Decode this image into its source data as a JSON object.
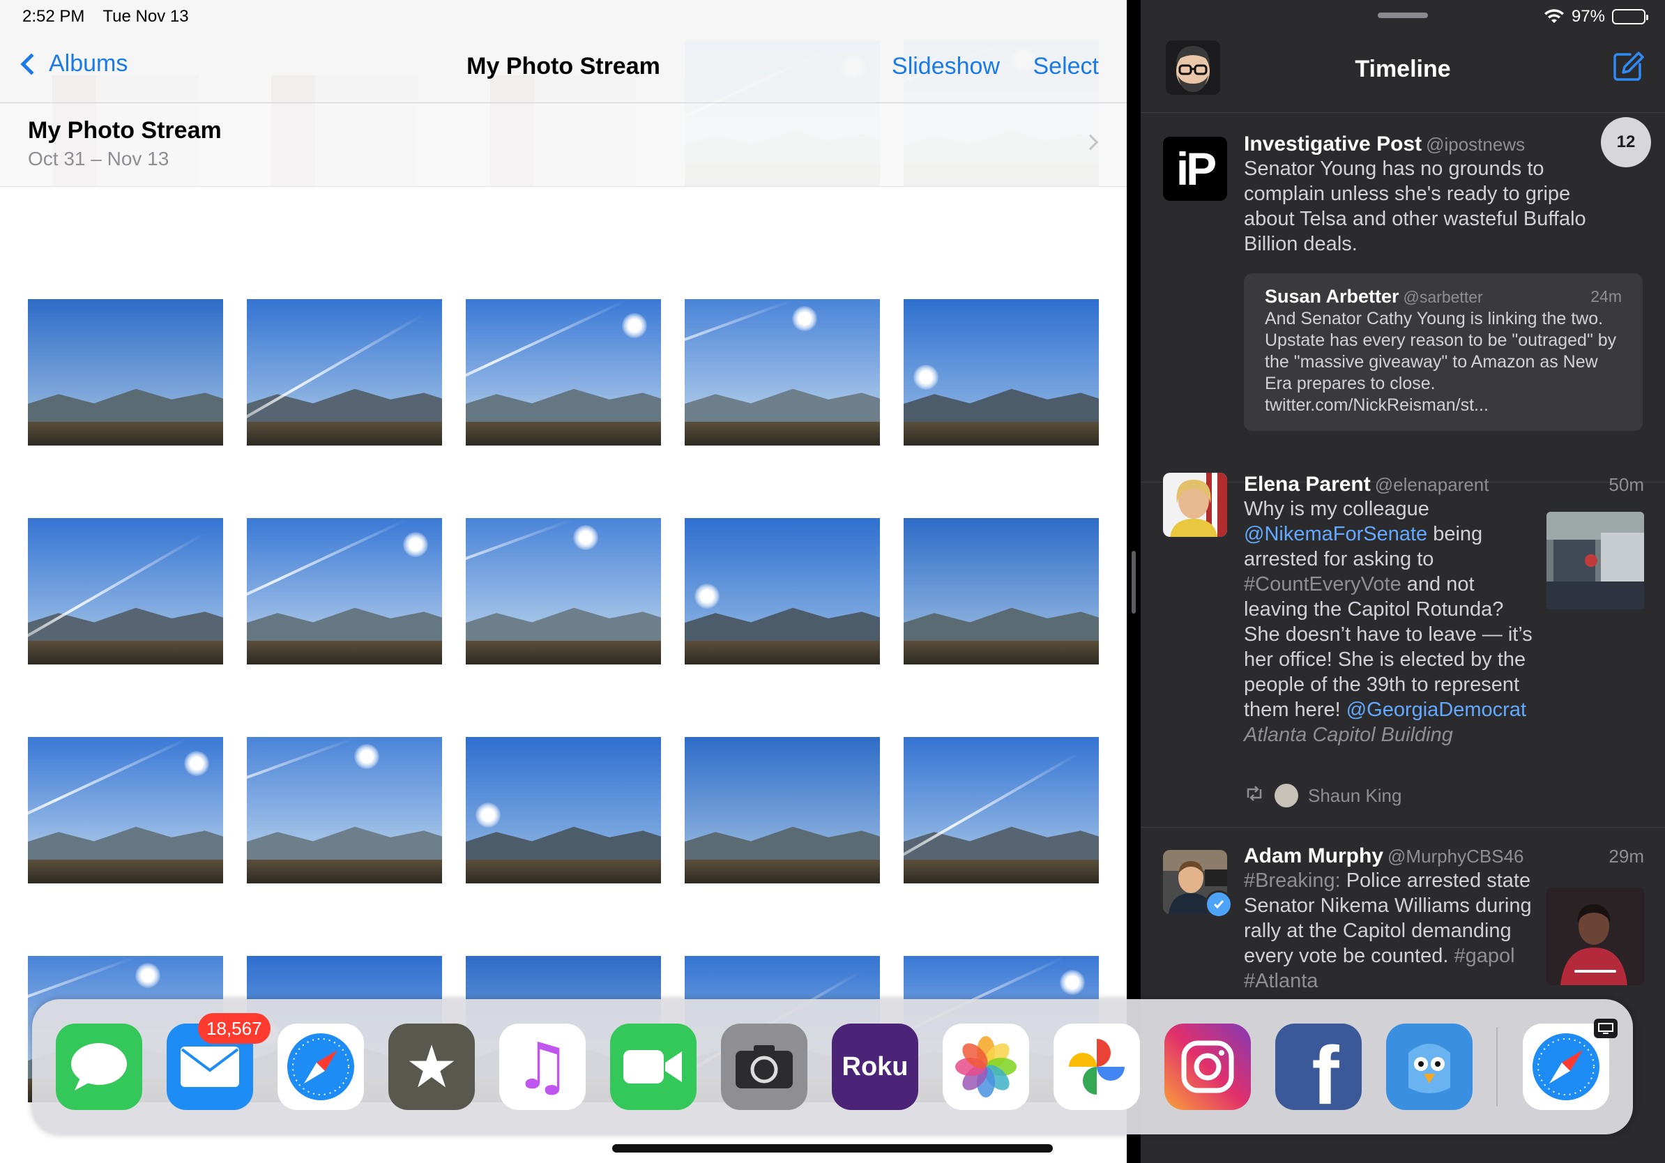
{
  "photos": {
    "status_time": "2:52 PM",
    "status_date": "Tue Nov 13",
    "nav": {
      "back_label": "Albums",
      "title": "My Photo Stream",
      "slideshow_label": "Slideshow",
      "select_label": "Select"
    },
    "section": {
      "title": "My Photo Stream",
      "dates": "Oct 31 – Nov 13"
    }
  },
  "tweetbot": {
    "battery": "97%",
    "title": "Timeline",
    "unread_badge": "12",
    "tweets": [
      {
        "name": "Investigative Post",
        "handle": "@ipostnews",
        "avatar_text": "iP",
        "text": "Senator Young has no grounds to complain unless she's ready to gripe about Telsa and other wasteful Buffalo Billion deals.",
        "quote": {
          "name": "Susan Arbetter",
          "handle": "@sarbetter",
          "time": "24m",
          "text": "And Senator Cathy Young is linking the two.  Upstate has every reason to be \"outraged\" by the \"massive giveaway\" to Amazon as New Era prepares to close. twitter.com/NickReisman/st..."
        }
      },
      {
        "name": "Elena Parent",
        "handle": "@elenaparent",
        "time": "50m",
        "text_1": "Why is my colleague",
        "mention_1": "@NikemaForSenate",
        "text_2": "being arrested for asking to",
        "hashtag_1": "#CountEveryVote",
        "text_3": "and not leaving the Capitol Rotunda? She doesn’t have to leave — it’s her office! She is elected by the people of the 39th to represent them here!",
        "mention_2": "@GeorgiaDemocrat",
        "place": "Atlanta Capitol Building",
        "retweeted_by": "Shaun King"
      },
      {
        "name": "Adam Murphy",
        "handle": "@MurphyCBS46",
        "time": "29m",
        "hashtag_1": "#Breaking:",
        "text_1": " Police arrested state Senator Nikema Williams during rally at the Capitol demanding every vote be counted.",
        "hashtag_2": " #gapol #Atlanta"
      }
    ]
  },
  "dock": {
    "mail_badge": "18,567",
    "apps": [
      {
        "name": "messages-app-icon",
        "label": "",
        "color": "#34c759"
      },
      {
        "name": "mail-app-icon",
        "label": "",
        "color": "#1e8cf5"
      },
      {
        "name": "safari-app-icon",
        "label": "",
        "color": "#1e8cf5"
      },
      {
        "name": "reeder-app-icon",
        "label": "★",
        "color": "#59584f"
      },
      {
        "name": "music-app-icon",
        "label": "♫",
        "color": "#ffffff"
      },
      {
        "name": "facetime-app-icon",
        "label": "",
        "color": "#34c759"
      },
      {
        "name": "camera-app-icon",
        "label": "",
        "color": "#8e8e93"
      },
      {
        "name": "roku-app-icon",
        "label": "Roku",
        "color": "#4b2377"
      },
      {
        "name": "photos-app-icon",
        "label": "",
        "color": "#ffffff"
      },
      {
        "name": "google-photos-app-icon",
        "label": "",
        "color": "#ffffff"
      },
      {
        "name": "instagram-app-icon",
        "label": "",
        "color": "#c13584"
      },
      {
        "name": "facebook-app-icon",
        "label": "f",
        "color": "#3b5998"
      },
      {
        "name": "tweetbot-app-icon",
        "label": "",
        "color": "#3b8fe0"
      },
      {
        "name": "safari-recent-app-icon",
        "label": "",
        "color": "#1e8cf5"
      }
    ]
  }
}
